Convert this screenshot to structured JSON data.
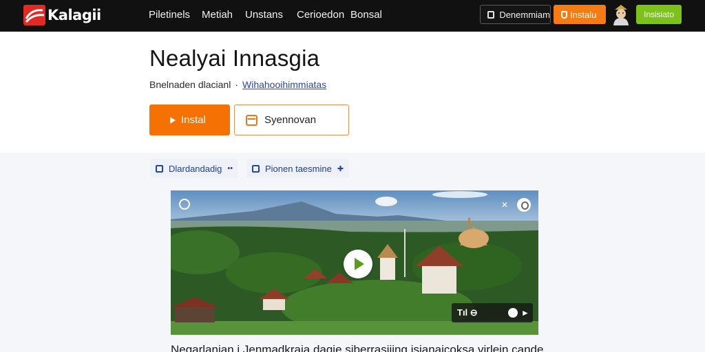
{
  "brand": {
    "name": "Kalagii",
    "color": "#e02a24"
  },
  "nav": [
    {
      "label": "Piletinels"
    },
    {
      "label": "Metiah"
    },
    {
      "label": "Unstans"
    },
    {
      "label": "Cerioedon"
    },
    {
      "label": "Bonsal"
    }
  ],
  "topbar_actions": {
    "demo_label": "Denemmiam",
    "install_label": "Instalu",
    "green_label": "Insisiato"
  },
  "header": {
    "title": "Nealyai Innasgia",
    "meta_text": "Bnelnaden dlacianl",
    "meta_link": "Wihahooihimmiatas"
  },
  "actions": {
    "install_label": "Instal",
    "sync_label": "Syennovan"
  },
  "chips": [
    {
      "label": "Dlardandadig",
      "tail": "••"
    },
    {
      "label": "Pionen taesmine",
      "tail": "✚"
    }
  ],
  "video": {
    "controls_label": "Tıl ⊖"
  },
  "description": "Negarlanian i Jenmadkraia dagie siberrasiiing isjanaicoksa virlein cande",
  "colors": {
    "accent": "#f57104",
    "green": "#7bc31b",
    "topbar": "#111111",
    "link": "#2546b8"
  },
  "icons": [
    "logo-icon",
    "window-icon",
    "install-icon",
    "avatar-icon",
    "play-icon",
    "calendar-icon",
    "clipboard-icon",
    "person-edit-icon",
    "circle-icon",
    "search-icon",
    "play-button-icon"
  ]
}
